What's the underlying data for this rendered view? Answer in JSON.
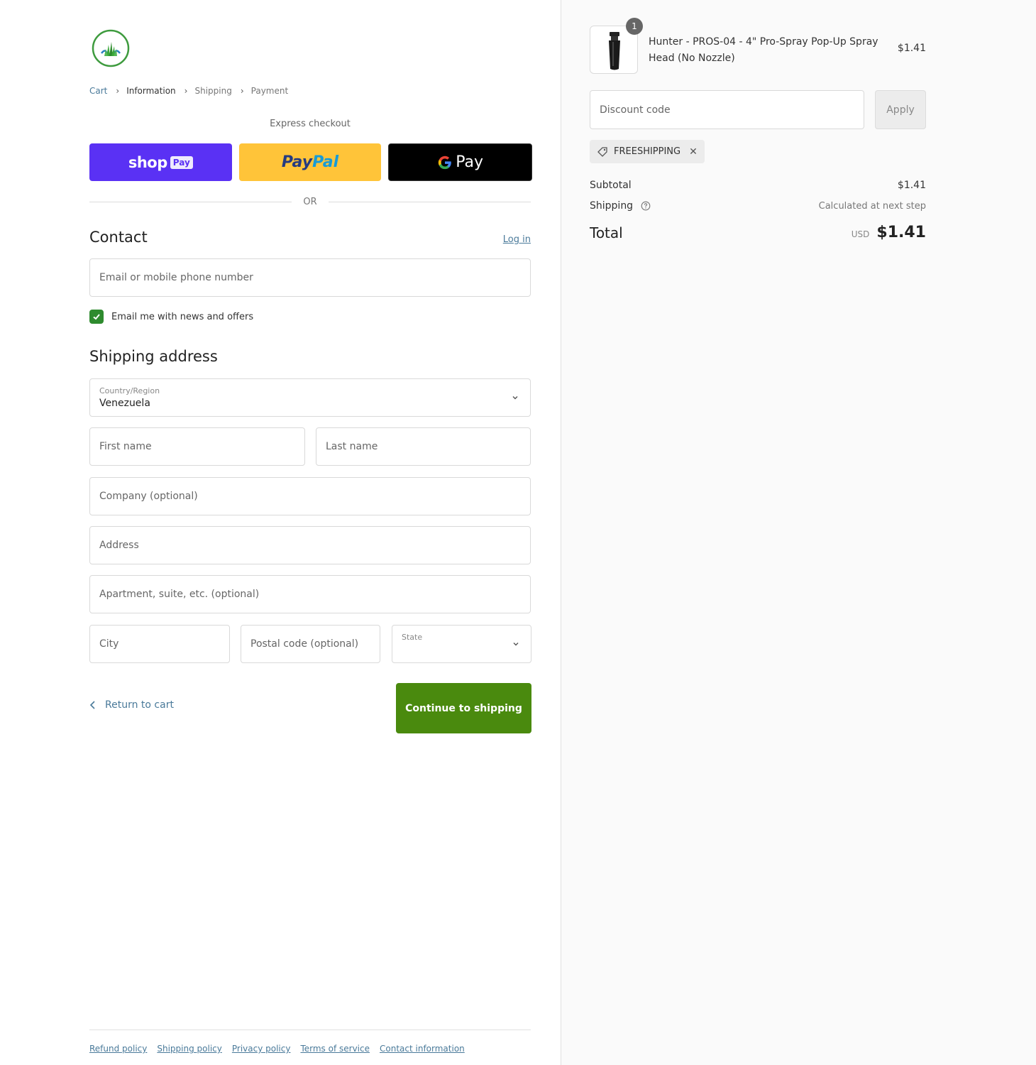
{
  "breadcrumb": {
    "cart": "Cart",
    "information": "Information",
    "shipping": "Shipping",
    "payment": "Payment"
  },
  "express": {
    "label": "Express checkout",
    "shop_text": "shop",
    "shop_pay": "Pay",
    "paypal_a": "Pay",
    "paypal_b": "Pal",
    "gpay_text": "Pay",
    "or": "OR"
  },
  "contact": {
    "heading": "Contact",
    "login": "Log in",
    "email_placeholder": "Email or mobile phone number",
    "newsletter_label": "Email me with news and offers",
    "newsletter_checked": true
  },
  "shipping": {
    "heading": "Shipping address",
    "country_label": "Country/Region",
    "country_value": "Venezuela",
    "first_name": "First name",
    "last_name": "Last name",
    "company": "Company (optional)",
    "address": "Address",
    "apartment": "Apartment, suite, etc. (optional)",
    "city": "City",
    "postal": "Postal code (optional)",
    "state": "State"
  },
  "actions": {
    "return": "Return to cart",
    "continue": "Continue to shipping"
  },
  "footer": {
    "links": [
      "Refund policy",
      "Shipping policy",
      "Privacy policy",
      "Terms of service",
      "Contact information"
    ]
  },
  "summary": {
    "product": {
      "qty": "1",
      "name": "Hunter - PROS-04 - 4\" Pro-Spray Pop-Up Spray Head (No Nozzle)",
      "price": "$1.41"
    },
    "discount_placeholder": "Discount code",
    "apply": "Apply",
    "applied_code": "FREESHIPPING",
    "subtotal_label": "Subtotal",
    "subtotal_value": "$1.41",
    "shipping_label": "Shipping",
    "shipping_value": "Calculated at next step",
    "total_label": "Total",
    "total_currency": "USD",
    "total_value": "$1.41"
  },
  "colors": {
    "accent_green": "#4a8a0e",
    "shop_purple": "#5a31f4",
    "paypal_yellow": "#ffc439",
    "link_blue": "#4a7a9a"
  }
}
